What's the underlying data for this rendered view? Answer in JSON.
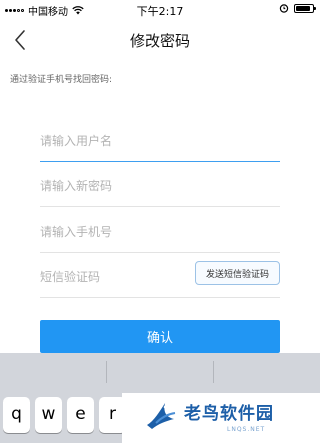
{
  "status_bar": {
    "carrier": "中国移动",
    "time": "下午2:17",
    "battery_level": 0.85
  },
  "nav": {
    "title": "修改密码"
  },
  "form": {
    "hint": "通过验证手机号找回密码:",
    "username": {
      "placeholder": "请输入用户名",
      "value": ""
    },
    "new_password": {
      "placeholder": "请输入新密码",
      "value": ""
    },
    "phone": {
      "placeholder": "请输入手机号",
      "value": ""
    },
    "sms_code": {
      "placeholder": "短信验证码",
      "value": ""
    },
    "send_code_label": "发送短信验证码",
    "confirm_label": "确认"
  },
  "keyboard": {
    "keys": [
      "q",
      "w",
      "e",
      "r"
    ]
  },
  "watermark": {
    "name": "老鸟软件园",
    "domain": "LNQS.NET"
  },
  "colors": {
    "accent": "#2196f3",
    "keyboard_bg": "#d2d5db"
  }
}
